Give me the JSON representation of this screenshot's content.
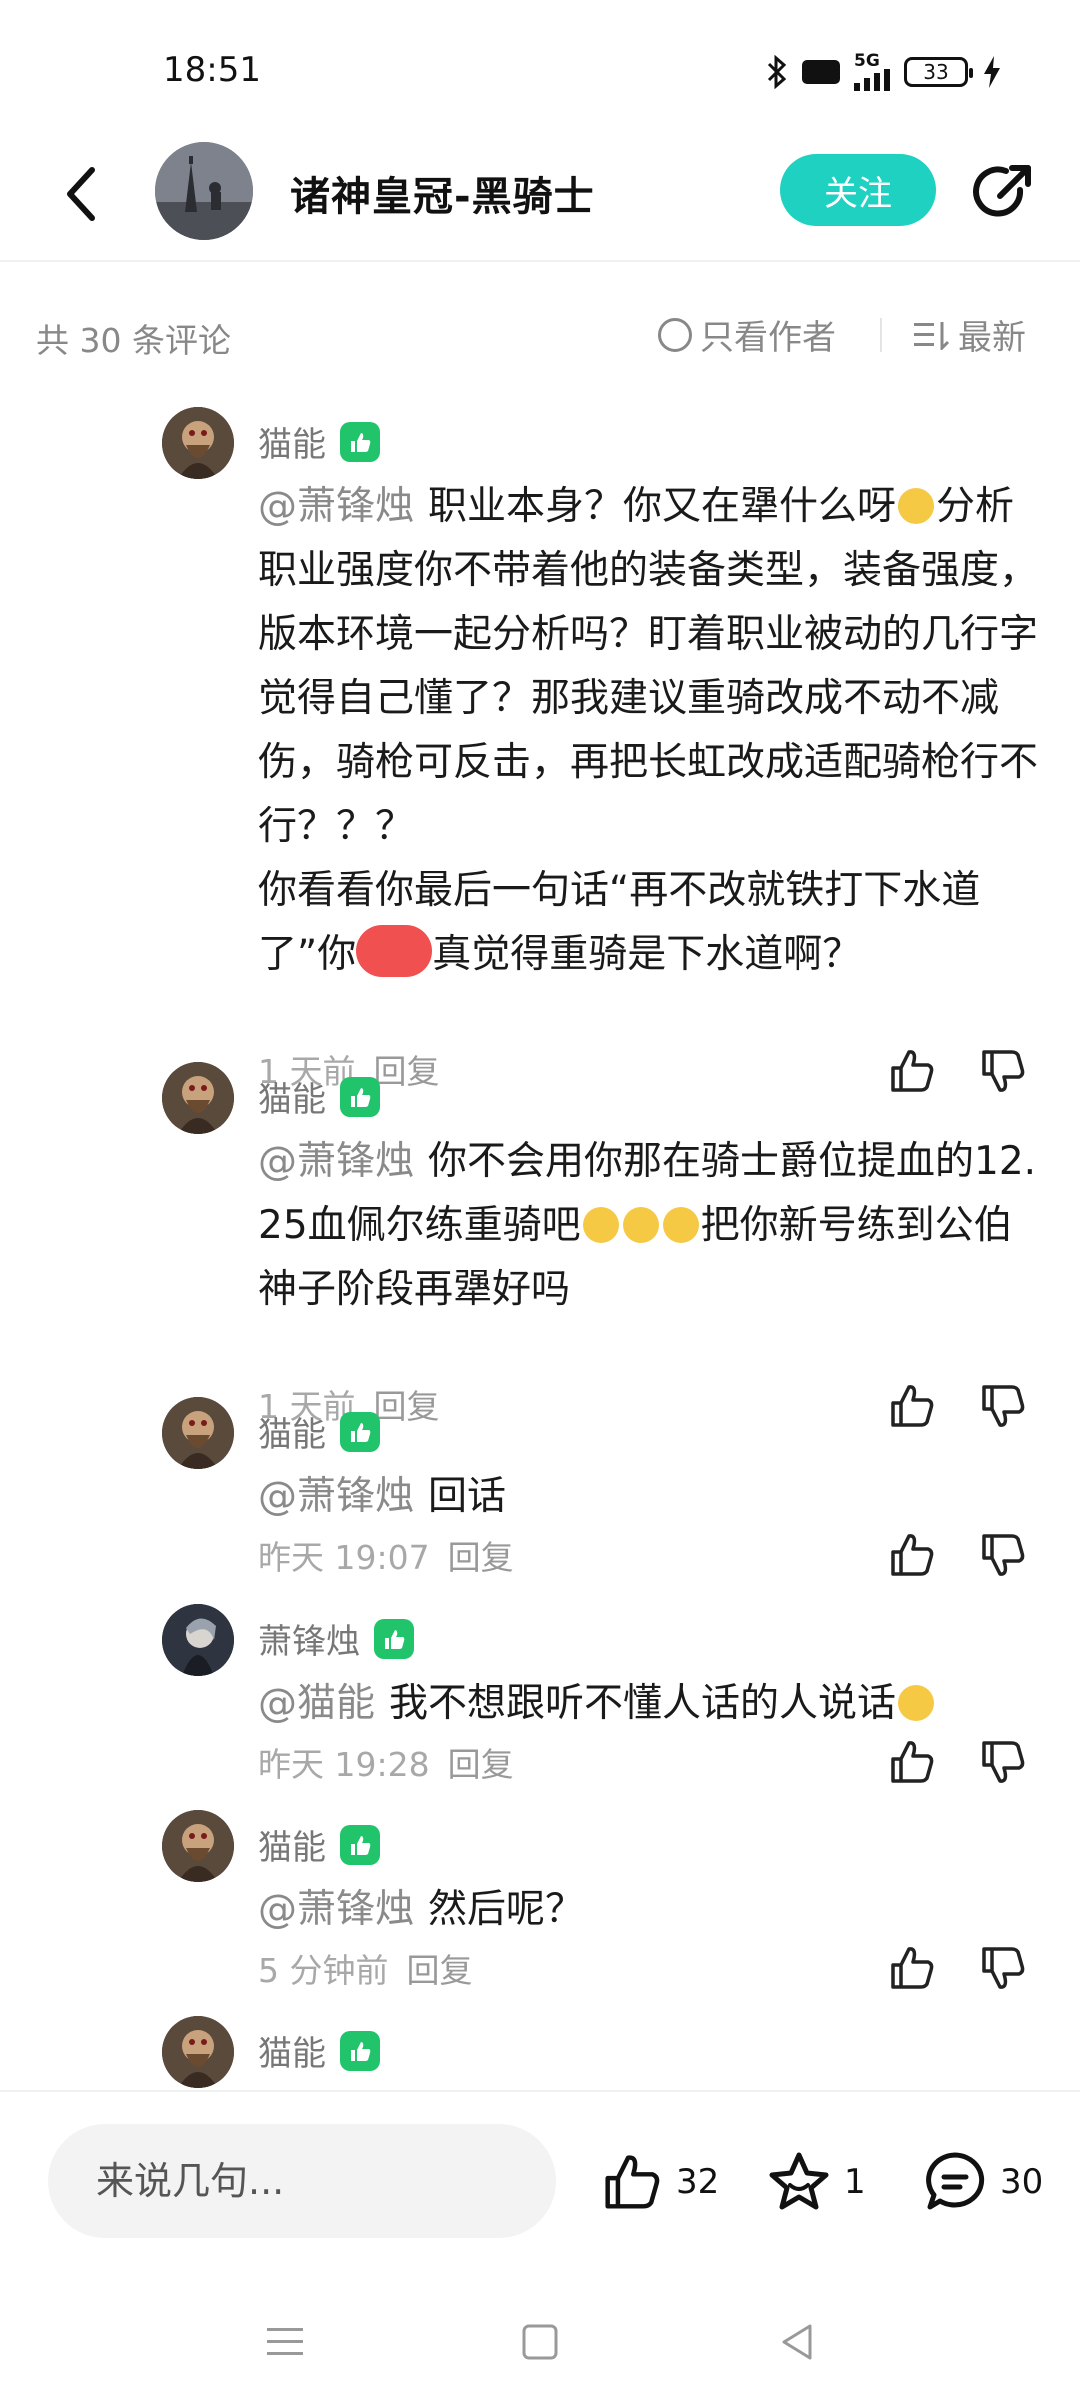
{
  "status_bar": {
    "time": "18:51",
    "network_label": "5G",
    "hd_label": "HD",
    "battery_level": "33"
  },
  "header": {
    "title": "诸神皇冠-黑骑士",
    "follow_label": "关注"
  },
  "filter": {
    "count_text": "共 30 条评论",
    "author_only_label": "只看作者",
    "sort_label": "最新"
  },
  "comments": [
    {
      "username": "猫能",
      "mention": "@萧锋烛",
      "text_1": "职业本身？你又在犟什么呀",
      "text_2": "分析职业强度你不带着他的装备类型，装备强度，版本环境一起分析吗？盯着职业被动的几行字觉得自己懂了？那我建议重骑改成不动不减伤，骑枪可反击，再把长虹改成适配骑枪行不行？？？",
      "text_3": "你看看你最后一句话“再不改就铁打下水道了”你",
      "text_4": "真觉得重骑是下水道啊？",
      "time": "1 天前",
      "reply_label": "回复"
    },
    {
      "username": "猫能",
      "mention": "@萧锋烛",
      "text_1": "你不会用你那在骑士爵位提血的12.25血佩尔练重骑吧",
      "text_2": "把你新号练到公伯神子阶段再犟好吗",
      "time": "1 天前",
      "reply_label": "回复"
    },
    {
      "username": "猫能",
      "mention": "@萧锋烛",
      "text_1": "回话",
      "time": "昨天 19:07",
      "reply_label": "回复"
    },
    {
      "username": "萧锋烛",
      "mention": "@猫能",
      "text_1": "我不想跟听不懂人话的人说话",
      "time": "昨天 19:28",
      "reply_label": "回复"
    },
    {
      "username": "猫能",
      "mention": "@萧锋烛",
      "text_1": "然后呢？",
      "time": "5 分钟前",
      "reply_label": "回复"
    },
    {
      "username": "猫能"
    }
  ],
  "bottom_bar": {
    "input_placeholder": "来说几句...",
    "like_count": "32",
    "star_count": "1",
    "comment_count": "30"
  },
  "colors": {
    "accent": "#1ed1c0",
    "badge_green": "#21c46a",
    "muted_text": "#a8a8a8"
  },
  "icons": {
    "back": "back-arrow-icon",
    "share": "share-icon",
    "like": "thumb-up-icon",
    "dislike": "thumb-down-icon",
    "star": "star-icon",
    "comment": "chat-bubble-icon"
  }
}
